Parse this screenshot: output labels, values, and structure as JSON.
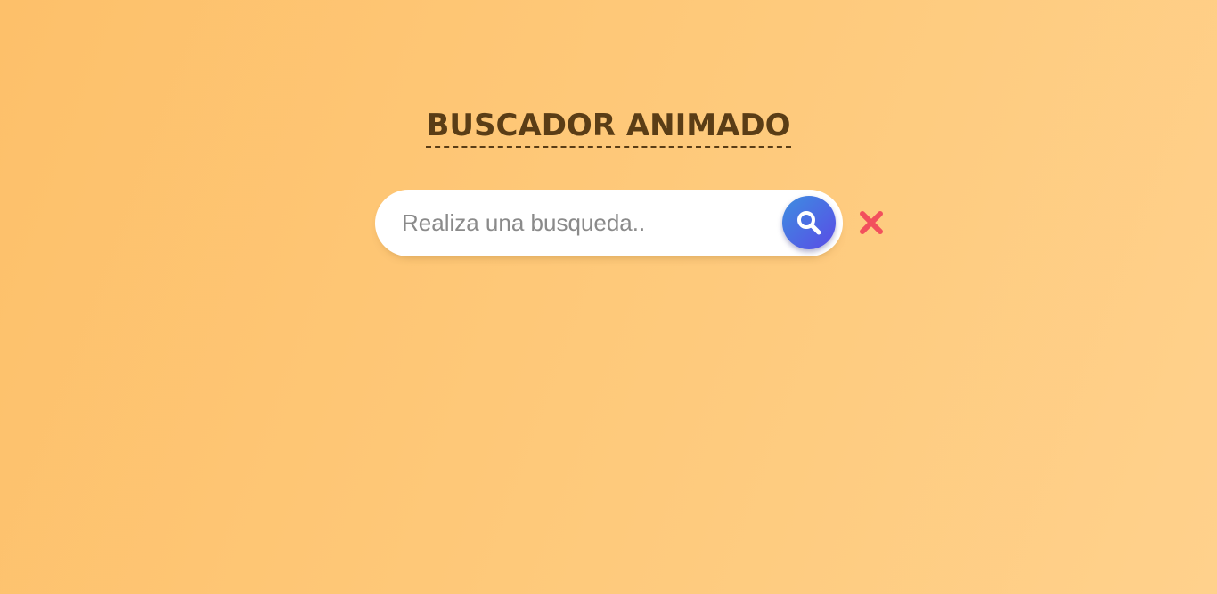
{
  "header": {
    "title": "BUSCADOR ANIMADO"
  },
  "search": {
    "placeholder": "Realiza una busqueda..",
    "value": ""
  },
  "icons": {
    "search": "search-icon",
    "close": "close-icon"
  },
  "colors": {
    "background_start": "#fdc06a",
    "background_end": "#ffd18c",
    "title": "#5a3d16",
    "search_button_start": "#3d8ee0",
    "search_button_end": "#5a4be6",
    "close_icon": "#f2505d"
  }
}
